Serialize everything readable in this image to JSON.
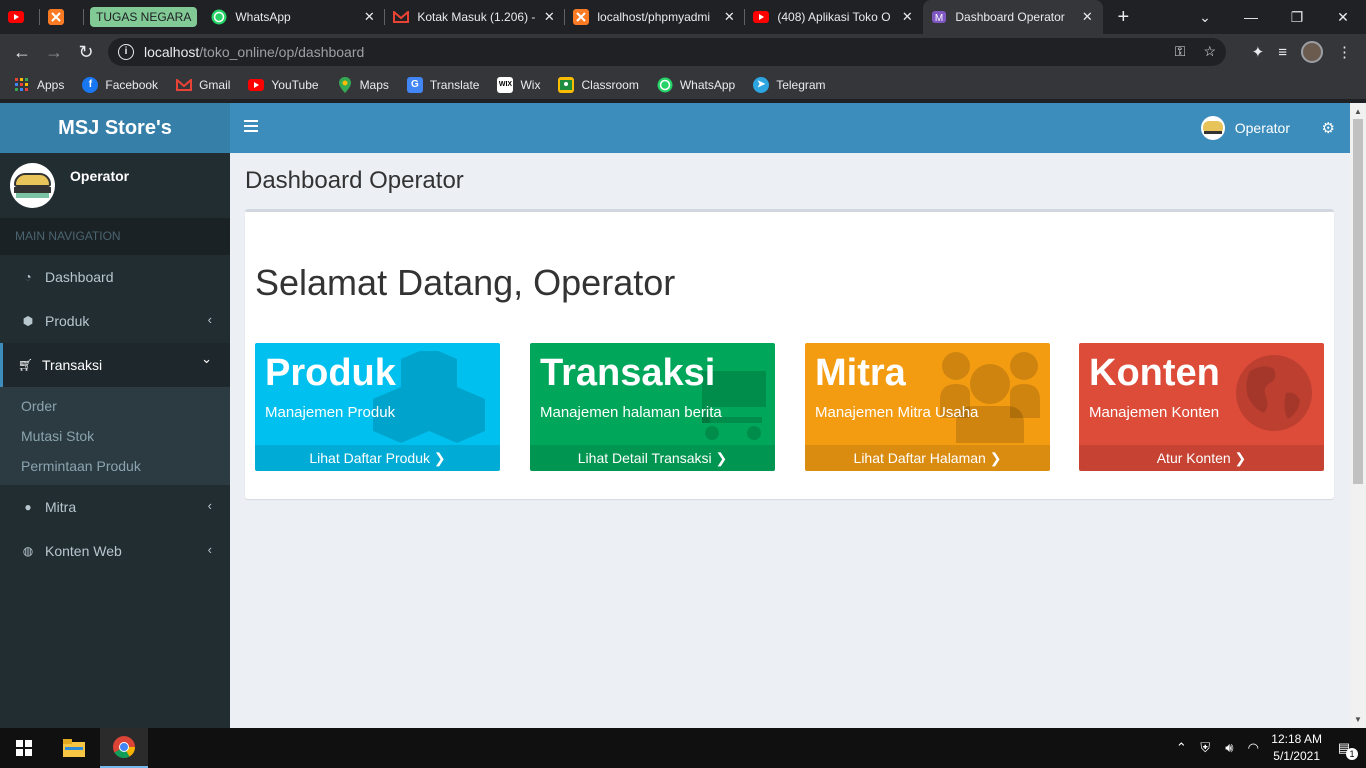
{
  "browser": {
    "tabs": [
      {
        "title": "",
        "icon": "youtube-icon",
        "has_close": false
      },
      {
        "title": "",
        "icon": "xampp-icon",
        "has_close": false
      },
      {
        "group_label": "TUGAS NEGARA"
      },
      {
        "title": "WhatsApp",
        "icon": "whatsapp-icon",
        "has_close": true
      },
      {
        "title": "Kotak Masuk (1.206) -",
        "icon": "gmail-icon",
        "has_close": true
      },
      {
        "title": "localhost/phpmyadmi",
        "icon": "xampp-icon",
        "has_close": true
      },
      {
        "title": "(408) Aplikasi Toko O",
        "icon": "youtube-icon",
        "has_close": true
      },
      {
        "title": "Dashboard Operator",
        "icon": "bootstrap-icon",
        "has_close": true,
        "active": true
      }
    ],
    "new_tab": "+",
    "url_host": "localhost",
    "url_path": "/toko_online/op/dashboard",
    "bookmarks": [
      {
        "label": "Apps",
        "icon": "apps-grid-icon"
      },
      {
        "label": "Facebook",
        "icon": "facebook-icon"
      },
      {
        "label": "Gmail",
        "icon": "gmail-icon"
      },
      {
        "label": "YouTube",
        "icon": "youtube-icon"
      },
      {
        "label": "Maps",
        "icon": "maps-icon"
      },
      {
        "label": "Translate",
        "icon": "translate-icon"
      },
      {
        "label": "Wix",
        "icon": "wix-icon"
      },
      {
        "label": "Classroom",
        "icon": "classroom-icon"
      },
      {
        "label": "WhatsApp",
        "icon": "whatsapp-icon"
      },
      {
        "label": "Telegram",
        "icon": "telegram-icon"
      }
    ]
  },
  "app": {
    "brand": "MSJ Store's",
    "top_user": "Operator",
    "sidebar": {
      "user_name": "Operator",
      "nav_header": "MAIN NAVIGATION",
      "items": [
        {
          "label": "Dashboard",
          "icon": "dashboard-icon"
        },
        {
          "label": "Produk",
          "icon": "cube-icon",
          "chevron": "‹"
        },
        {
          "label": "Transaksi",
          "icon": "cart-icon",
          "chevron": "⌄"
        },
        {
          "label": "Mitra",
          "icon": "user-icon",
          "chevron": "‹"
        },
        {
          "label": "Konten Web",
          "icon": "globe-icon",
          "chevron": "‹"
        }
      ],
      "transaksi_sub": [
        "Order",
        "Mutasi Stok",
        "Permintaan Produk"
      ]
    },
    "page_title": "Dashboard Operator",
    "welcome": "Selamat Datang, Operator",
    "cards": [
      {
        "title": "Produk",
        "subtitle": "Manajemen Produk",
        "footer": "Lihat Daftar Produk",
        "color": "#00c0ef",
        "icon": "cubes-icon"
      },
      {
        "title": "Transaksi",
        "subtitle": "Manajemen halaman berita",
        "footer": "Lihat Detail Transaksi",
        "color": "#00a65a",
        "icon": "cart-icon"
      },
      {
        "title": "Mitra",
        "subtitle": "Manajemen Mitra Usaha",
        "footer": "Lihat Daftar Halaman",
        "color": "#f39c12",
        "icon": "users-icon"
      },
      {
        "title": "Konten",
        "subtitle": "Manajemen Konten",
        "footer": "Atur Konten",
        "color": "#dd4b39",
        "icon": "globe-icon"
      }
    ]
  },
  "taskbar": {
    "time": "12:18 AM",
    "date": "5/1/2021",
    "notification_count": "1"
  }
}
